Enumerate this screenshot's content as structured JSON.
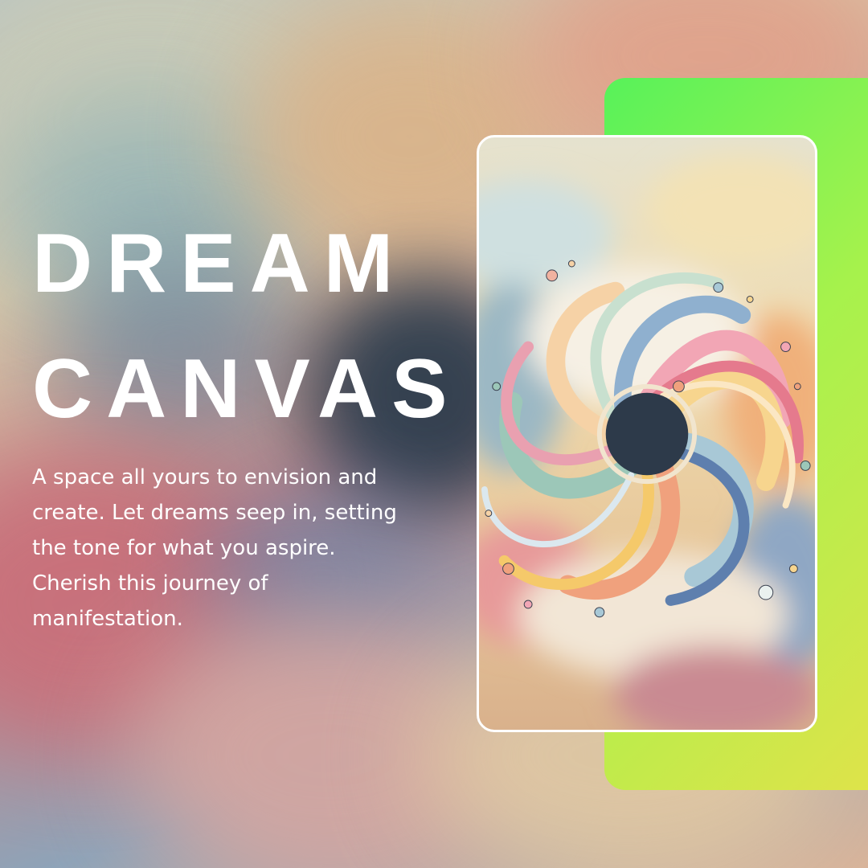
{
  "title": {
    "line1": "DREAM",
    "line2": "CANVAS"
  },
  "description": "A space all yours to envision and create. Let dreams seep in, setting the tone for what you aspire. Cherish this journey of manifestation.",
  "artwork": {
    "subject": "swirl-vortex-illustration"
  },
  "colors": {
    "accent_start": "#57f25a",
    "accent_end": "#dfe34a",
    "text": "#ffffff",
    "card_border": "#ffffff"
  }
}
